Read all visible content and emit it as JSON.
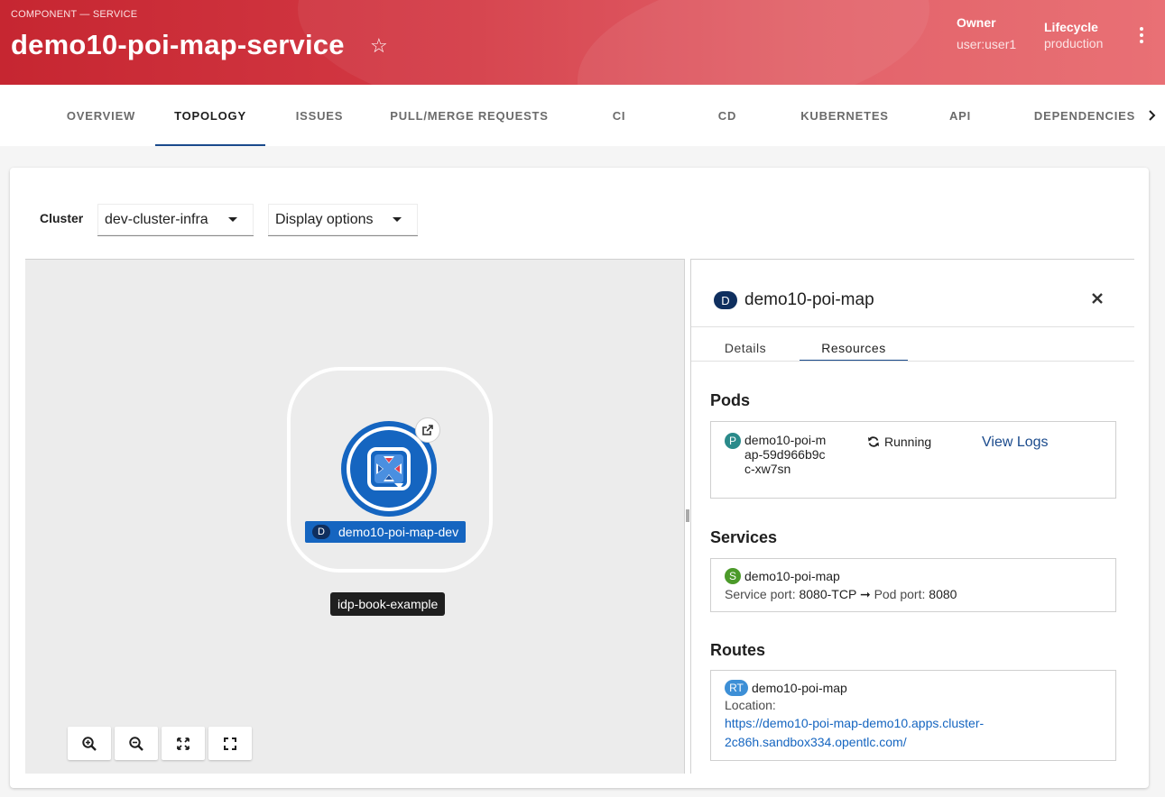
{
  "header": {
    "kind": "COMPONENT — SERVICE",
    "title": "demo10-poi-map-service",
    "star_icon": "star-outline-icon",
    "owner_label": "Owner",
    "owner_value": "user:user1",
    "lifecycle_label": "Lifecycle",
    "lifecycle_value": "production",
    "menu_icon": "kebab-icon"
  },
  "tabs": [
    {
      "label": "OVERVIEW"
    },
    {
      "label": "TOPOLOGY"
    },
    {
      "label": "ISSUES"
    },
    {
      "label": "PULL/MERGE REQUESTS"
    },
    {
      "label": "CI"
    },
    {
      "label": "CD"
    },
    {
      "label": "KUBERNETES"
    },
    {
      "label": "API"
    },
    {
      "label": "DEPENDENCIES"
    }
  ],
  "active_tab": "TOPOLOGY",
  "filters": {
    "cluster_label": "Cluster",
    "cluster_value": "dev-cluster-infra",
    "display_options_label": "Display options"
  },
  "topology": {
    "node_badge": "D",
    "node_label": "demo10-poi-map-dev",
    "group_label": "idp-book-example",
    "controls": [
      "zoom-in-icon",
      "zoom-out-icon",
      "fit-to-screen-icon",
      "expand-icon"
    ]
  },
  "panel": {
    "badge": "D",
    "title": "demo10-poi-map",
    "tabs": [
      "Details",
      "Resources"
    ],
    "active_tab": "Resources",
    "pods": {
      "heading": "Pods",
      "badge": "P",
      "name": "demo10-poi-map-59d966b9cc-xw7sn",
      "status": "Running",
      "logs_link": "View Logs"
    },
    "services": {
      "heading": "Services",
      "badge": "S",
      "name": "demo10-poi-map",
      "service_port_label": "Service port:",
      "service_port_value": "8080-TCP",
      "arrow": "➞",
      "pod_port_label": "Pod port:",
      "pod_port_value": "8080"
    },
    "routes": {
      "heading": "Routes",
      "badge": "RT",
      "name": "demo10-poi-map",
      "location_label": "Location:",
      "location_line1": "https://demo10-poi-map-demo10.apps.cluster-",
      "location_line2": "2c86h.sandbox334.opentlc.com/"
    }
  },
  "colors": {
    "header_red": "#c62631",
    "accent_blue": "#1565c0",
    "deployment_badge": "#0f2f5f",
    "pod_badge": "#2a8a8a",
    "service_badge": "#4c9a2a",
    "route_badge": "#3d8fd6"
  }
}
